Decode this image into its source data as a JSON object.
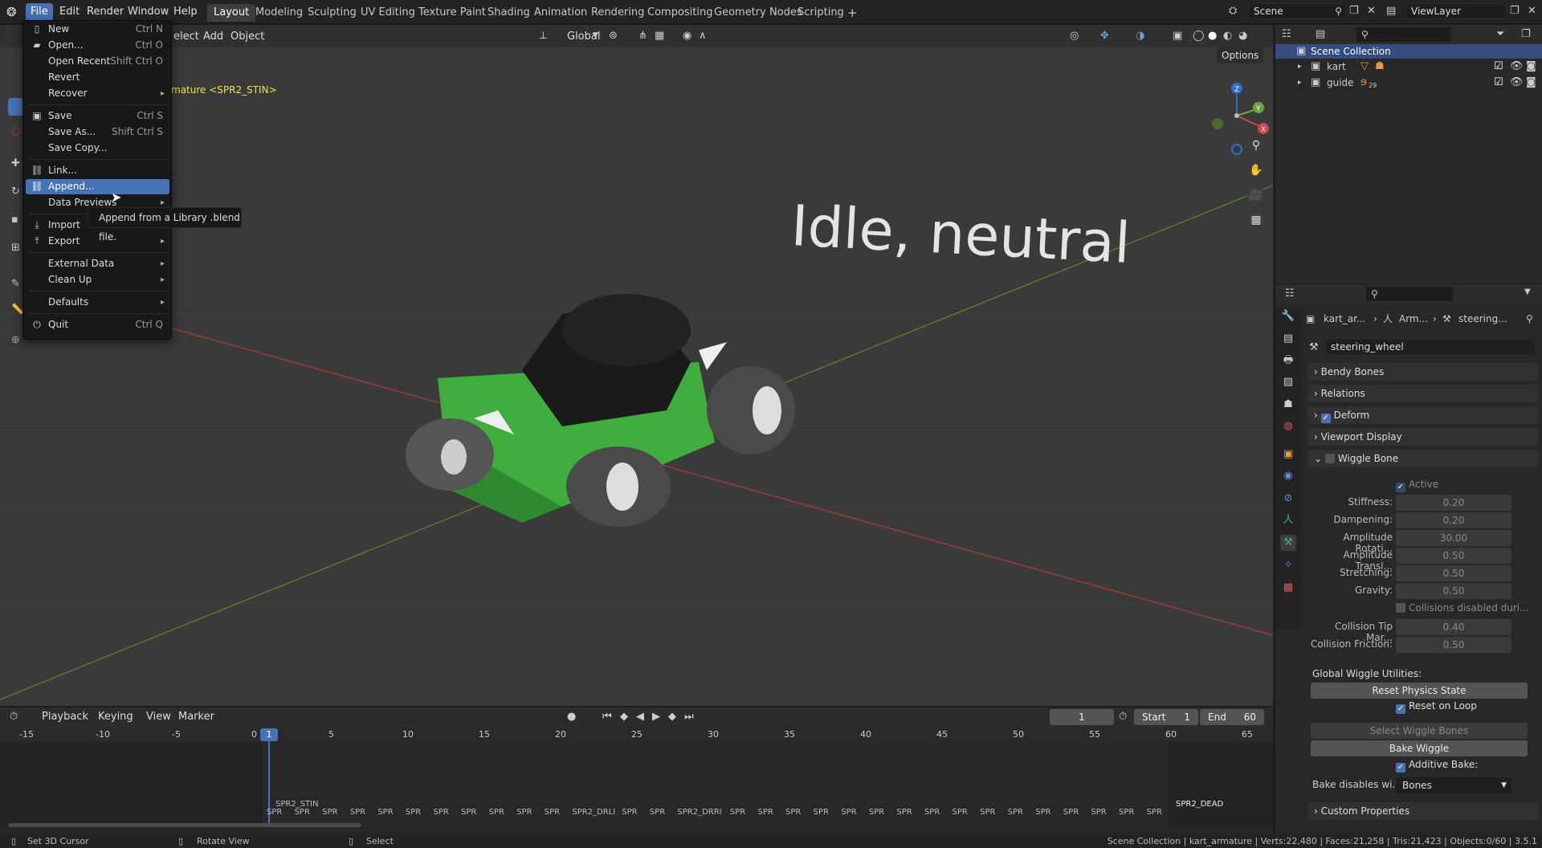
{
  "topbar": {
    "menus": [
      "File",
      "Edit",
      "Render",
      "Window",
      "Help"
    ],
    "workspaces": [
      "Layout",
      "Modeling",
      "Sculpting",
      "UV Editing",
      "Texture Paint",
      "Shading",
      "Animation",
      "Rendering",
      "Compositing",
      "Geometry Nodes",
      "Scripting"
    ],
    "add_tab": "+",
    "scene": "Scene",
    "view_layer": "ViewLayer"
  },
  "viewport_header": {
    "select": "elect",
    "add": "Add",
    "object": "Object",
    "orientation": "Global",
    "options": "Options"
  },
  "viewport": {
    "overlay_text": "mature <SPR2_STIN>",
    "scene_text": "Idle, neutral",
    "gizmo": {
      "z": "Z",
      "y": "Y",
      "x": "X"
    }
  },
  "file_menu": {
    "items": [
      {
        "label": "New",
        "shortcut": "Ctrl N",
        "icon": "new-file-icon"
      },
      {
        "label": "Open...",
        "shortcut": "Ctrl O",
        "icon": "folder-icon"
      },
      {
        "label": "Open Recent",
        "shortcut": "Shift Ctrl O"
      },
      {
        "label": "Revert",
        "shortcut": ""
      },
      {
        "label": "Recover",
        "shortcut": ""
      },
      {
        "label": "Save",
        "shortcut": "Ctrl S",
        "icon": "save-icon"
      },
      {
        "label": "Save As...",
        "shortcut": "Shift Ctrl S"
      },
      {
        "label": "Save Copy...",
        "shortcut": ""
      },
      {
        "label": "Link...",
        "shortcut": "",
        "icon": "link-icon"
      },
      {
        "label": "Append...",
        "shortcut": "",
        "icon": "append-icon"
      },
      {
        "label": "Data Previews",
        "shortcut": ""
      },
      {
        "label": "Import",
        "shortcut": "",
        "icon": "import-icon"
      },
      {
        "label": "Export",
        "shortcut": "",
        "icon": "export-icon"
      },
      {
        "label": "External Data",
        "shortcut": ""
      },
      {
        "label": "Clean Up",
        "shortcut": ""
      },
      {
        "label": "Defaults",
        "shortcut": ""
      },
      {
        "label": "Quit",
        "shortcut": "Ctrl Q",
        "icon": "power-icon"
      }
    ],
    "tooltip": "Append from a Library .blend file."
  },
  "outliner": {
    "root": "Scene Collection",
    "items": [
      {
        "label": "kart"
      },
      {
        "label": "guide",
        "badge": "29"
      }
    ]
  },
  "properties": {
    "breadcrumb": [
      "kart_ar...",
      "Arm...",
      "steering..."
    ],
    "bone_name": "steering_wheel",
    "panels": [
      "Bendy Bones",
      "Relations",
      "Deform",
      "Viewport Display",
      "Wiggle Bone"
    ],
    "wiggle": {
      "active": "Active",
      "fields": [
        {
          "label": "Stiffness:",
          "value": "0.20"
        },
        {
          "label": "Dampening:",
          "value": "0.20"
        },
        {
          "label": "Amplitude Rotati...",
          "value": "30.00"
        },
        {
          "label": "Amplitude Transl...",
          "value": "0.50"
        },
        {
          "label": "Stretching:",
          "value": "0.50"
        },
        {
          "label": "Gravity:",
          "value": "0.50"
        }
      ],
      "collisions_disabled": "Collisions disabled duri...",
      "fields2": [
        {
          "label": "Collision Tip Mar...",
          "value": "0.40"
        },
        {
          "label": "Collision Friction:",
          "value": "0.50"
        }
      ]
    },
    "global_utils": "Global Wiggle Utilities:",
    "reset_physics": "Reset Physics State",
    "reset_on_loop": "Reset on Loop",
    "select_wiggle": "Select Wiggle Bones",
    "bake_wiggle": "Bake Wiggle",
    "additive_bake": "Additive Bake:",
    "bake_disables_label": "Bake disables wi...",
    "bake_disables_value": "Bones",
    "custom_props": "Custom Properties"
  },
  "timeline": {
    "menus": [
      "Playback",
      "Keying",
      "View",
      "Marker"
    ],
    "current_frame": "1",
    "start_label": "Start",
    "start": "1",
    "end_label": "End",
    "end": "60",
    "ruler": [
      "-15",
      "-10",
      "-5",
      "0",
      "5",
      "10",
      "15",
      "20",
      "25",
      "30",
      "35",
      "40",
      "45",
      "50",
      "55",
      "60",
      "65"
    ],
    "playhead": "1",
    "markers_top": "SPR2_STIN",
    "markers_end": "SPR2_DEAD",
    "marker_row": [
      "SPR",
      "SPR",
      "SPR",
      "SPR",
      "SPR",
      "SPR",
      "SPR",
      "SPR",
      "SPR",
      "SPR",
      "SPR",
      "SPR2_DRLI",
      "SPR",
      "SPR",
      "SPR2_DRRI",
      "SPR",
      "SPR",
      "SPR",
      "SPR",
      "SPR",
      "SPR",
      "SPR",
      "SPR",
      "SPR",
      "SPR",
      "SPR",
      "SPR",
      "SPR",
      "SPR",
      "SPR",
      "SPR"
    ]
  },
  "status": {
    "left1": "Set 3D Cursor",
    "left2": "Rotate View",
    "left3": "Select",
    "right": "Scene Collection | kart_armature | Verts:22,480 | Faces:21,258 | Tris:21,423 | Objects:0/60 | 3.5.1"
  }
}
